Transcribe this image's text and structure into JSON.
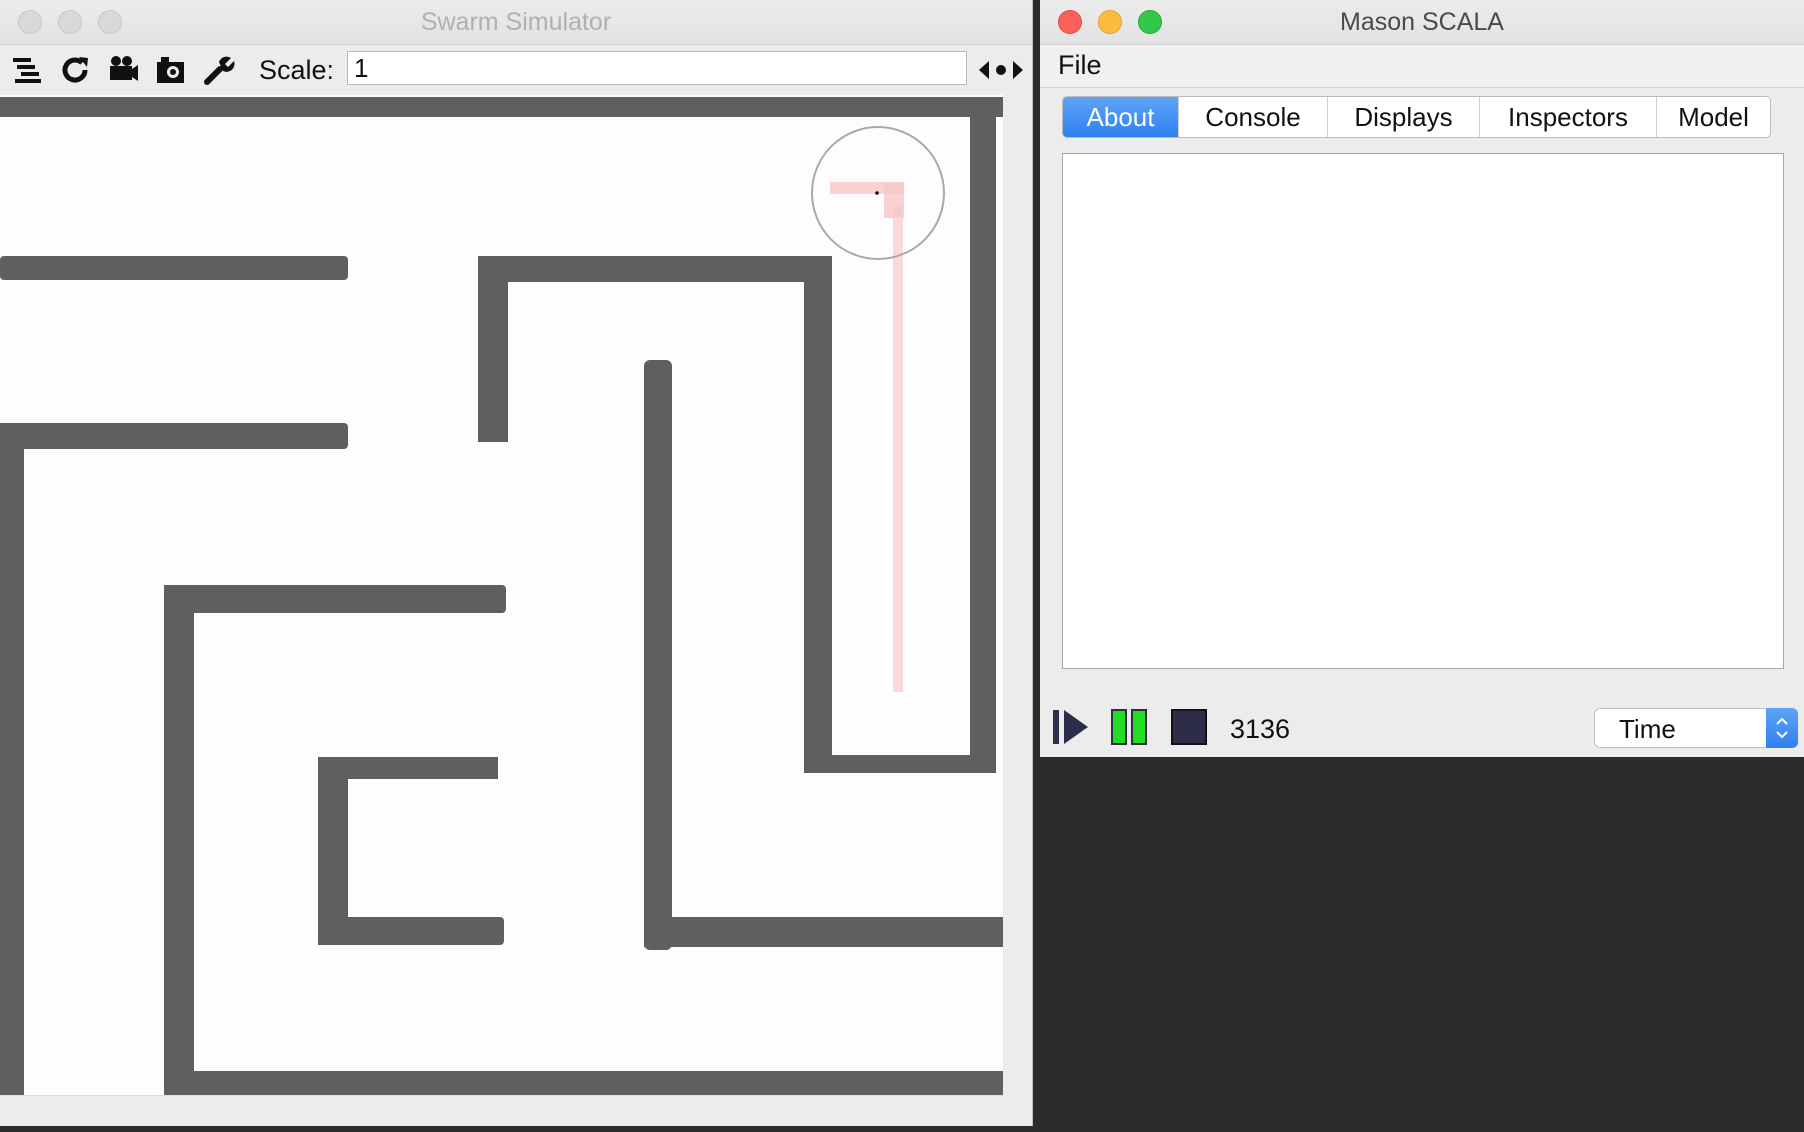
{
  "simulator": {
    "title": "Swarm Simulator",
    "toolbar": {
      "icons": [
        "layers-icon",
        "refresh-icon",
        "movie-camera-icon",
        "snapshot-camera-icon",
        "wrench-icon"
      ],
      "scale_label": "Scale:",
      "scale_value": "1"
    }
  },
  "mason": {
    "title": "Mason SCALA",
    "menu": {
      "file": "File"
    },
    "tabs": [
      "About",
      "Console",
      "Displays",
      "Inspectors",
      "Model"
    ],
    "active_tab": "About",
    "controls": {
      "step_count": "3136",
      "time_select": "Time"
    },
    "colors": {
      "accent": "#2e7ff0",
      "pause_green": "#22dd22",
      "control_navy": "#2d2d4a"
    }
  }
}
